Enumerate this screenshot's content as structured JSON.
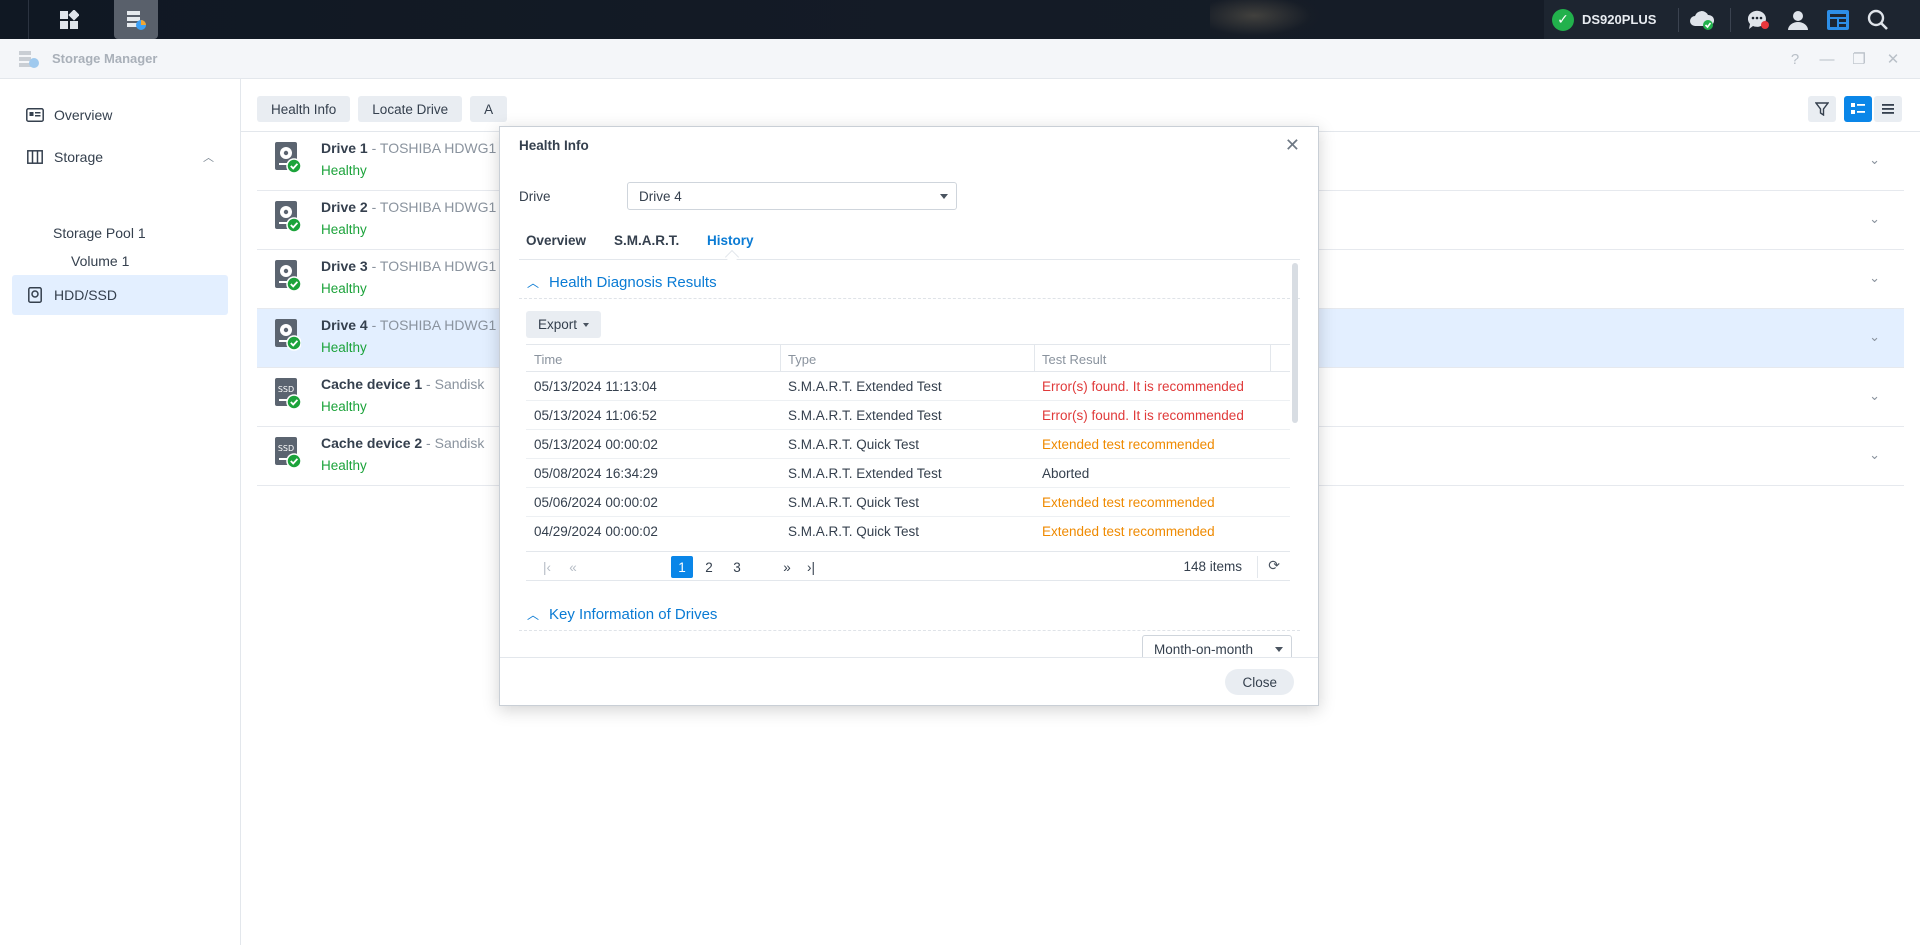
{
  "taskbar": {
    "server_name": "DS920PLUS"
  },
  "window": {
    "title": "Storage Manager"
  },
  "sidebar": {
    "overview": "Overview",
    "storage": "Storage",
    "storage_pool": "Storage Pool 1",
    "volume": "Volume 1",
    "hdd_ssd": "HDD/SSD"
  },
  "toolbar": {
    "health_info": "Health Info",
    "locate_drive": "Locate Drive",
    "partial": "A"
  },
  "drives": [
    {
      "name": "Drive 1",
      "model": " - TOSHIBA HDWG1",
      "status": "Healthy",
      "kind": "hdd"
    },
    {
      "name": "Drive 2",
      "model": " - TOSHIBA HDWG1",
      "status": "Healthy",
      "kind": "hdd"
    },
    {
      "name": "Drive 3",
      "model": " - TOSHIBA HDWG1",
      "status": "Healthy",
      "kind": "hdd"
    },
    {
      "name": "Drive 4",
      "model": " - TOSHIBA HDWG1",
      "status": "Healthy",
      "kind": "hdd"
    },
    {
      "name": "Cache device 1",
      "model": " - Sandisk",
      "status": "Healthy",
      "kind": "ssd"
    },
    {
      "name": "Cache device 2",
      "model": " - Sandisk",
      "status": "Healthy",
      "kind": "ssd"
    }
  ],
  "modal": {
    "title": "Health Info",
    "drive_label": "Drive",
    "drive_value": "Drive 4",
    "tabs": [
      "Overview",
      "S.M.A.R.T.",
      "History"
    ],
    "section1": "Health Diagnosis Results",
    "export": "Export",
    "columns": [
      "Time",
      "Type",
      "Test Result"
    ],
    "rows": [
      {
        "time": "05/13/2024 11:13:04",
        "type": "S.M.A.R.T. Extended Test",
        "result": "Error(s) found. It is recommended",
        "level": "red"
      },
      {
        "time": "05/13/2024 11:06:52",
        "type": "S.M.A.R.T. Extended Test",
        "result": "Error(s) found. It is recommended",
        "level": "red"
      },
      {
        "time": "05/13/2024 00:00:02",
        "type": "S.M.A.R.T. Quick Test",
        "result": "Extended test recommended",
        "level": "orange"
      },
      {
        "time": "05/08/2024 16:34:29",
        "type": "S.M.A.R.T. Extended Test",
        "result": "Aborted",
        "level": "normal"
      },
      {
        "time": "05/06/2024 00:00:02",
        "type": "S.M.A.R.T. Quick Test",
        "result": "Extended test recommended",
        "level": "orange"
      },
      {
        "time": "04/29/2024 00:00:02",
        "type": "S.M.A.R.T. Quick Test",
        "result": "Extended test recommended",
        "level": "orange"
      }
    ],
    "pages": [
      "1",
      "2",
      "3"
    ],
    "item_count": "148 items",
    "section2": "Key Information of Drives",
    "period": "Month-on-month",
    "close": "Close"
  }
}
